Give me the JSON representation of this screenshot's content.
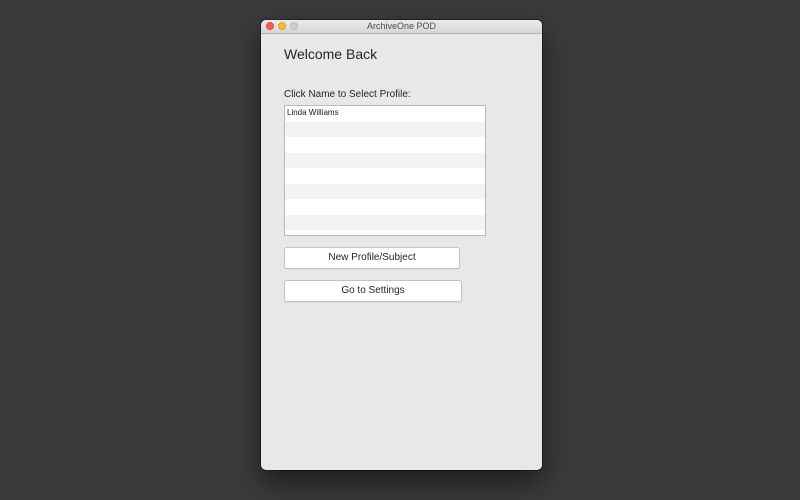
{
  "window": {
    "title": "ArchiveOne POD"
  },
  "main": {
    "heading": "Welcome Back",
    "list_label": "Click Name to Select Profile:",
    "profiles": [
      "Linda Williams",
      "",
      "",
      "",
      "",
      "",
      "",
      ""
    ],
    "new_profile_button": "New Profile/Subject",
    "settings_button": "Go to Settings"
  },
  "colors": {
    "desktop": "#3b3b3b",
    "window_bg": "#e8e8e8",
    "close": "#fc5f57",
    "minimize": "#fdbb2e",
    "zoom_disabled": "#cdcdcd"
  }
}
